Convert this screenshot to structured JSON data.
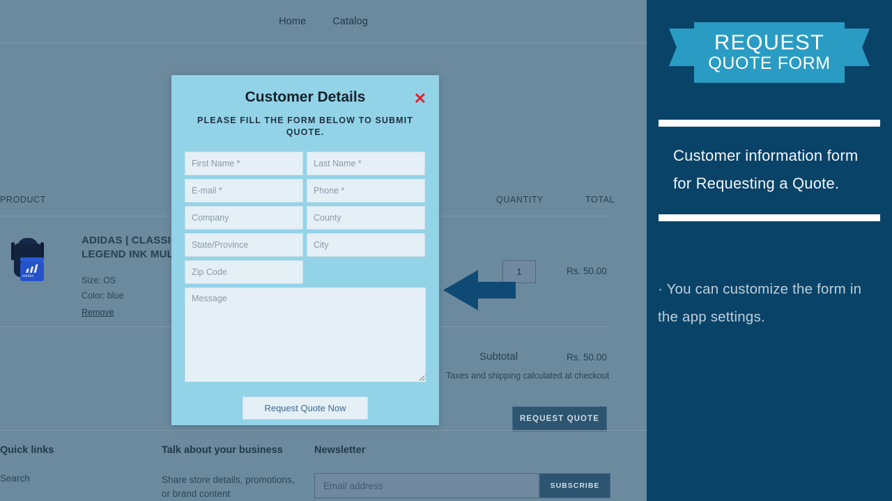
{
  "nav": {
    "items": [
      "Home",
      "Catalog"
    ]
  },
  "cart": {
    "columns": {
      "product": "PRODUCT",
      "quantity": "QUANTITY",
      "total": "TOTAL"
    },
    "item": {
      "title": "ADIDAS | CLASSIC BACKPACK | LEGEND INK MULTICOLOUR",
      "size": "Size: OS",
      "color": "Color: blue",
      "remove": "Remove",
      "quantity": "1",
      "total": "Rs. 50.00",
      "image_alt": "adidas-backpack-thumbnail",
      "logo_word": "adidas"
    },
    "subtotal_label": "Subtotal",
    "subtotal_value": "Rs. 50.00",
    "tax_note": "Taxes and shipping calculated at checkout",
    "request_quote_button": "REQUEST QUOTE"
  },
  "modal": {
    "title": "Customer Details",
    "close": "✕",
    "subtitle": "PLEASE FILL THE FORM BELOW TO SUBMIT QUOTE.",
    "fields": [
      {
        "name": "first-name",
        "placeholder": "First Name *"
      },
      {
        "name": "last-name",
        "placeholder": "Last Name *"
      },
      {
        "name": "email",
        "placeholder": "E-mail *"
      },
      {
        "name": "phone",
        "placeholder": "Phone *"
      },
      {
        "name": "company",
        "placeholder": "Company"
      },
      {
        "name": "county",
        "placeholder": "County"
      },
      {
        "name": "state-province",
        "placeholder": "State/Province"
      },
      {
        "name": "city",
        "placeholder": "City"
      },
      {
        "name": "zip-code",
        "placeholder": "Zip Code"
      }
    ],
    "message_placeholder": "Message",
    "submit_label": "Request Quote Now"
  },
  "footer": {
    "quick_links_title": "Quick links",
    "quick_links": [
      "Search"
    ],
    "business_title": "Talk about your business",
    "business_text": "Share store details, promotions, or brand content",
    "newsletter_title": "Newsletter",
    "newsletter_placeholder": "Email address",
    "subscribe_label": "SUBSCRIBE"
  },
  "panel": {
    "ribbon_line1": "REQUEST",
    "ribbon_line2": "QUOTE FORM",
    "description": "Customer information form for Requesting a Quote.",
    "note": "· You can customize the form in the app settings."
  },
  "colors": {
    "page_bg": "#6b8a9e",
    "panel_bg": "#0a4368",
    "ribbon": "#2a9cc4",
    "modal_bg": "#93d3e8",
    "input_bg": "#e4eff6",
    "accent_button": "#2d5470",
    "close_red": "#e0232c",
    "arrow": "#0e4a74"
  }
}
